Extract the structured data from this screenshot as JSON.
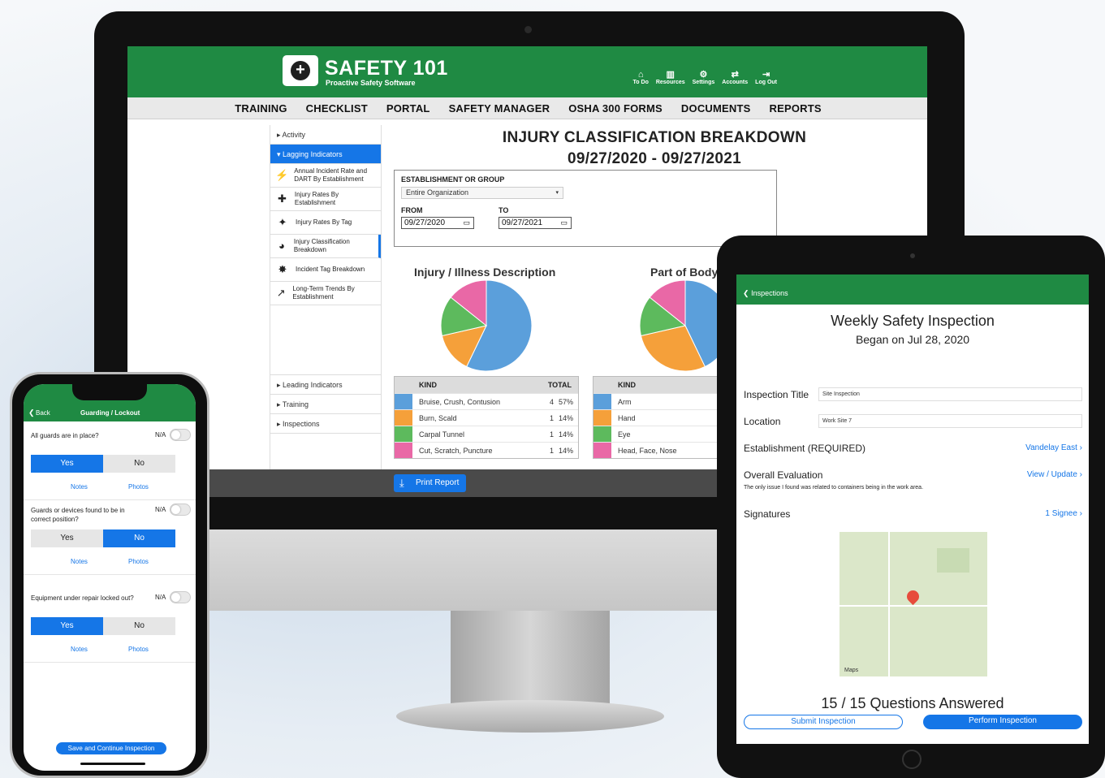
{
  "desktop": {
    "brand": "SAFETY 101",
    "tagline": "Proactive Safety Software",
    "top_icons": [
      {
        "label": "To Do",
        "icon": "home-icon",
        "glyph": "⌂"
      },
      {
        "label": "Resources",
        "icon": "book-icon",
        "glyph": "▥"
      },
      {
        "label": "Settings",
        "icon": "gear-icon",
        "glyph": "⚙"
      },
      {
        "label": "Accounts",
        "icon": "swap-icon",
        "glyph": "⇄"
      },
      {
        "label": "Log Out",
        "icon": "logout-icon",
        "glyph": "⇥"
      }
    ],
    "nav": [
      "TRAINING",
      "CHECKLIST",
      "PORTAL",
      "SAFETY MANAGER",
      "OSHA 300 FORMS",
      "DOCUMENTS",
      "REPORTS"
    ],
    "sidebar": {
      "activity": "Activity",
      "lagging": "Lagging Indicators",
      "subitems": [
        {
          "label": "Annual Incident Rate and DART By Establishment",
          "icon": "fall-icon",
          "glyph": "⚡"
        },
        {
          "label": "Injury Rates By Establishment",
          "icon": "injury-rates-icon",
          "glyph": "✚"
        },
        {
          "label": "Injury Rates By Tag",
          "icon": "tag-icon",
          "glyph": "✦"
        },
        {
          "label": "Injury Classification Breakdown",
          "icon": "pie-icon",
          "glyph": "◕"
        },
        {
          "label": "Incident Tag Breakdown",
          "icon": "tag-breakdown-icon",
          "glyph": "✸"
        },
        {
          "label": "Long-Term Trends By Establishment",
          "icon": "trend-icon",
          "glyph": "↗"
        }
      ],
      "leading": "Leading Indicators",
      "training": "Training",
      "inspections": "Inspections"
    },
    "report": {
      "title": "INJURY CLASSIFICATION BREAKDOWN",
      "date_range": "09/27/2020 - 09/27/2021",
      "est_label": "ESTABLISHMENT OR GROUP",
      "est_value": "Entire Organization",
      "from_label": "FROM",
      "from_value": "09/27/2020",
      "to_label": "TO",
      "to_value": "09/27/2021",
      "print_label": "Print Report"
    },
    "table_headers": {
      "kind": "KIND",
      "total": "TOTAL"
    }
  },
  "chart_data": [
    {
      "type": "pie",
      "title": "Injury / Illness Description",
      "categories": [
        "Bruise, Crush, Contusion",
        "Burn, Scald",
        "Carpal Tunnel",
        "Cut, Scratch, Puncture"
      ],
      "values": [
        4,
        1,
        1,
        1
      ],
      "percent_labels": [
        "57%",
        "14%",
        "14%",
        "14%"
      ],
      "colors": [
        "#5b9fdb",
        "#f5a03a",
        "#5dba5d",
        "#e968a6"
      ]
    },
    {
      "type": "pie",
      "title": "Part of Body",
      "categories": [
        "Arm",
        "Hand",
        "Eye",
        "Head, Face, Nose"
      ],
      "values": [
        3,
        2,
        1,
        1
      ],
      "colors": [
        "#5b9fdb",
        "#f5a03a",
        "#5dba5d",
        "#e968a6"
      ]
    }
  ],
  "tablet": {
    "back": "Inspections",
    "title": "Weekly Safety Inspection",
    "subtitle": "Began on Jul 28, 2020",
    "inspection_title_label": "Inspection Title",
    "inspection_title_value": "Site Inspection",
    "location_label": "Location",
    "location_value": "Work Site 7",
    "establishment_label": "Establishment (REQUIRED)",
    "establishment_value": "Vandelay East",
    "overall_label": "Overall Evaluation",
    "overall_link": "View / Update",
    "overall_note": "The only issue I found was related to containers being in the work area.",
    "signatures_label": "Signatures",
    "signatures_value": "1 Signee",
    "maps_label": "Maps",
    "questions": "15 / 15 Questions Answered",
    "submit": "Submit Inspection",
    "perform": "Perform Inspection"
  },
  "phone": {
    "back": "Back",
    "title": "Guarding / Lockout",
    "na": "N/A",
    "questions": [
      {
        "text": "All guards are in place?",
        "answer": "Yes",
        "notes": "Notes",
        "photos": "Photos"
      },
      {
        "text": "Guards or devices found to be in correct position?",
        "answer": "No",
        "notes": "Notes",
        "photos": "Photos"
      },
      {
        "text": "Equipment under repair locked out?",
        "answer": "Yes",
        "notes": "Notes",
        "photos": "Photos"
      }
    ],
    "yes": "Yes",
    "no": "No",
    "save": "Save and Continue Inspection"
  }
}
